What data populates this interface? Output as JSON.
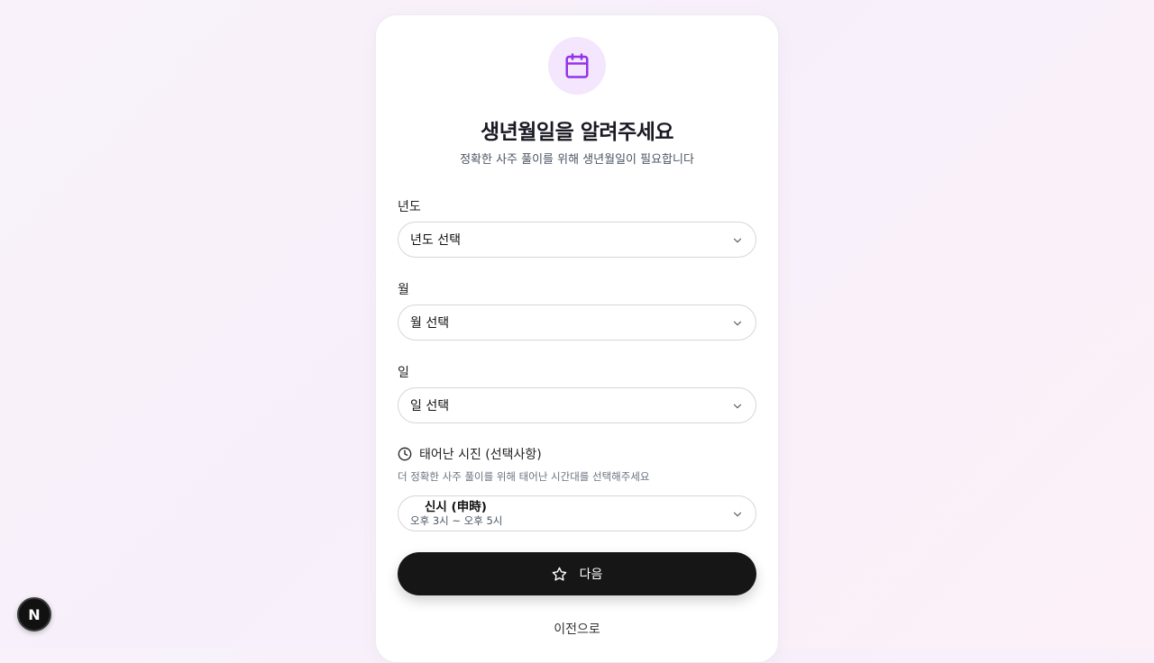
{
  "header": {
    "icon": "calendar-icon",
    "accent_color": "#9333ea",
    "icon_bg_color": "#f3e6fd",
    "title": "생년월일을 알려주세요",
    "subtitle": "정확한 사주 풀이를 위해 생년월일이 필요합니다"
  },
  "form": {
    "year": {
      "label": "년도",
      "value": "년도 선택"
    },
    "month": {
      "label": "월",
      "value": "월 선택"
    },
    "day": {
      "label": "일",
      "value": "일 선택"
    },
    "time": {
      "icon": "clock-icon",
      "label": "태어난 시진 (선택사항)",
      "help": "더 정확한 사주 풀이를 위해 태어난 시간대를 선택해주세요",
      "selected_name": "신시 (申時)",
      "selected_range": "오후 3시 ~ 오후 5시"
    }
  },
  "actions": {
    "next_icon": "star-icon",
    "next_label": "다음",
    "prev_label": "이전으로"
  },
  "devtools": {
    "logo_icon": "nextjs-logo-icon",
    "logo_letter": "N"
  }
}
